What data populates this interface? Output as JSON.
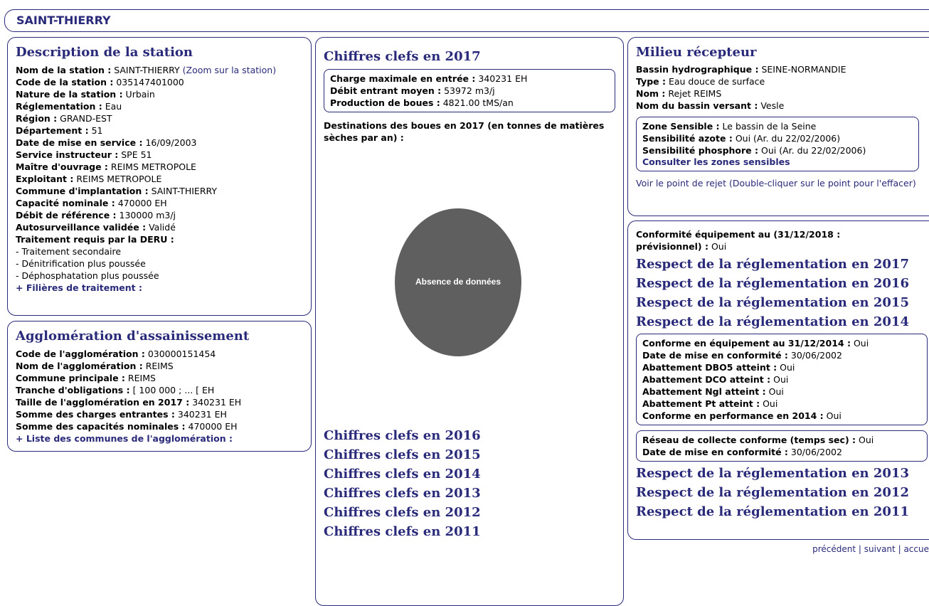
{
  "title": "SAINT-THIERRY",
  "description": {
    "heading": "Description de la station",
    "zoom_link": "(Zoom sur la station)",
    "fields": [
      {
        "label": "Nom de la station :",
        "value": "SAINT-THIERRY"
      },
      {
        "label": "Code de la station :",
        "value": "035147401000"
      },
      {
        "label": "Nature de la station :",
        "value": "Urbain"
      },
      {
        "label": "Réglementation :",
        "value": "Eau"
      },
      {
        "label": "Région :",
        "value": "GRAND-EST"
      },
      {
        "label": "Département :",
        "value": "51"
      },
      {
        "label": "Date de mise en service :",
        "value": "16/09/2003"
      },
      {
        "label": "Service instructeur :",
        "value": "SPE 51"
      },
      {
        "label": "Maître d'ouvrage :",
        "value": "REIMS METROPOLE"
      },
      {
        "label": "Exploitant :",
        "value": "REIMS METROPOLE"
      },
      {
        "label": "Commune d'implantation :",
        "value": "SAINT-THIERRY"
      },
      {
        "label": "Capacité nominale :",
        "value": "470000 EH"
      },
      {
        "label": "Débit de référence :",
        "value": "130000 m3/j"
      },
      {
        "label": "Autosurveillance validée :",
        "value": "Validé"
      },
      {
        "label": "Traitement requis par la DERU :",
        "value": ""
      }
    ],
    "treatments": [
      "- Traitement secondaire",
      "- Dénitrification plus poussée",
      "- Déphosphatation plus poussée"
    ],
    "filieres_link": "+ Filières de traitement :"
  },
  "agglomeration": {
    "heading": "Agglomération d'assainissement",
    "fields": [
      {
        "label": "Code de l'agglomération :",
        "value": "030000151454"
      },
      {
        "label": "Nom de l'agglomération :",
        "value": "REIMS"
      },
      {
        "label": "Commune principale :",
        "value": "REIMS"
      },
      {
        "label": "Tranche d'obligations :",
        "value": "[ 100 000 ; ... [ EH"
      },
      {
        "label": "Taille de l'agglomération en 2017 :",
        "value": "340231 EH"
      },
      {
        "label": "Somme des charges entrantes :",
        "value": "340231 EH"
      },
      {
        "label": "Somme des capacités nominales :",
        "value": "470000 EH"
      }
    ],
    "communes_link": "+ Liste des communes de l'agglomération :"
  },
  "chiffres": {
    "heading": "Chiffres clefs en 2017",
    "fields": [
      {
        "label": "Charge maximale en entrée :",
        "value": "340231 EH"
      },
      {
        "label": "Débit entrant moyen :",
        "value": "53972 m3/j"
      },
      {
        "label": "Production de boues :",
        "value": "4821.00 tMS/an"
      }
    ],
    "destinations_label": "Destinations des boues en 2017 (en tonnes de matières sèches par an) :",
    "pie_label": "Absence de données",
    "pie_color": "#5f5f5f",
    "years": [
      "Chiffres clefs en 2016",
      "Chiffres clefs en 2015",
      "Chiffres clefs en 2014",
      "Chiffres clefs en 2013",
      "Chiffres clefs en 2012",
      "Chiffres clefs en 2011"
    ]
  },
  "milieu": {
    "heading": "Milieu récepteur",
    "fields": [
      {
        "label": "Bassin hydrographique :",
        "value": "SEINE-NORMANDIE"
      },
      {
        "label": "Type :",
        "value": "Eau douce de surface"
      },
      {
        "label": "Nom :",
        "value": "Rejet REIMS"
      },
      {
        "label": "Nom du bassin versant :",
        "value": "Vesle"
      }
    ],
    "zone_fields": [
      {
        "label": "Zone Sensible :",
        "value": "Le bassin de la Seine"
      },
      {
        "label": "Sensibilité azote :",
        "value": "Oui (Ar. du 22/02/2006)"
      },
      {
        "label": "Sensibilité phosphore :",
        "value": "Oui (Ar. du 22/02/2006)"
      }
    ],
    "zones_link": "Consulter les zones sensibles",
    "rejet_link": "Voir le point de rejet (Double-cliquer sur le point pour l'effacer)"
  },
  "conformite": {
    "equip_label": "Conformité équipement au (31/12/2018 : prévisionnel) :",
    "equip_value": "Oui",
    "respect_top": [
      "Respect de la réglementation en 2017",
      "Respect de la réglementation en 2016",
      "Respect de la réglementation en 2015",
      "Respect de la réglementation en 2014"
    ],
    "detail_fields": [
      {
        "label": "Conforme en équipement au 31/12/2014 :",
        "value": "Oui"
      },
      {
        "label": "Date de mise en conformité :",
        "value": "30/06/2002"
      },
      {
        "label": "Abattement DBO5 atteint :",
        "value": "Oui"
      },
      {
        "label": "Abattement DCO atteint :",
        "value": "Oui"
      },
      {
        "label": "Abattement Ngl atteint :",
        "value": "Oui"
      },
      {
        "label": "Abattement Pt atteint :",
        "value": "Oui"
      },
      {
        "label": "Conforme en performance en 2014 :",
        "value": "Oui"
      }
    ],
    "reseau_fields": [
      {
        "label": "Réseau de collecte conforme (temps sec) :",
        "value": "Oui"
      },
      {
        "label": "Date de mise en conformité :",
        "value": "30/06/2002"
      }
    ],
    "respect_bottom": [
      "Respect de la réglementation en 2013",
      "Respect de la réglementation en 2012",
      "Respect de la réglementation en 2011"
    ]
  },
  "pager": {
    "prev": "précédent",
    "sep": "|",
    "next": "suivant",
    "home": "accue"
  }
}
